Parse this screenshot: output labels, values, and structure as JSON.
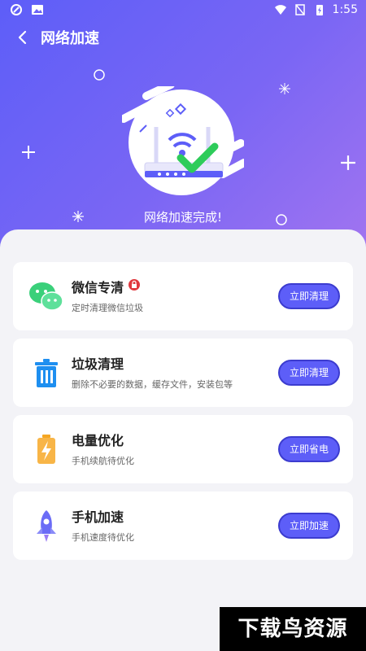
{
  "status_bar": {
    "time": "1:55"
  },
  "header": {
    "title": "网络加速",
    "back_icon": "chevron-left-icon"
  },
  "result": {
    "message": "网络加速完成!"
  },
  "colors": {
    "primary": "#5d5ef8",
    "accent": "#7a66f4",
    "lock": "#e0383e",
    "check": "#2ecc5a"
  },
  "items": [
    {
      "name": "微信专清",
      "desc": "定时清理微信垃圾",
      "button": "立即清理",
      "icon": "wechat-icon",
      "locked": true
    },
    {
      "name": "垃圾清理",
      "desc": "删除不必要的数据，缓存文件，安装包等",
      "button": "立即清理",
      "icon": "trash-icon",
      "locked": false
    },
    {
      "name": "电量优化",
      "desc": "手机续航待优化",
      "button": "立即省电",
      "icon": "battery-icon",
      "locked": false
    },
    {
      "name": "手机加速",
      "desc": "手机速度待优化",
      "button": "立即加速",
      "icon": "rocket-icon",
      "locked": false
    }
  ],
  "watermark": "下载鸟资源"
}
